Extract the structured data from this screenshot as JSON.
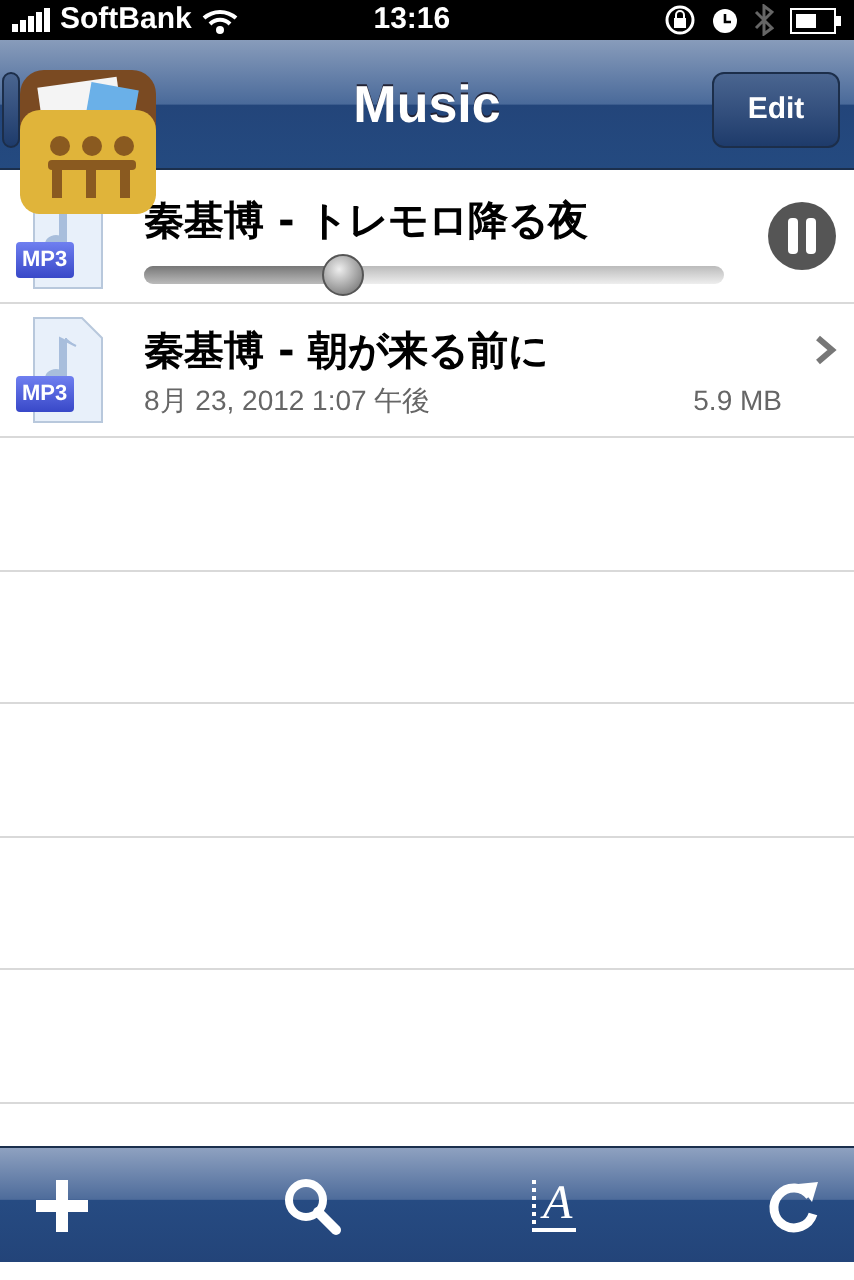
{
  "status_bar": {
    "carrier": "SoftBank",
    "time": "13:16"
  },
  "nav_bar": {
    "title": "Music",
    "edit_button": "Edit"
  },
  "files": [
    {
      "title": "秦基博 - トレモロ降る夜",
      "badge": "MP3",
      "playing": true,
      "level": 0.34
    },
    {
      "title": "秦基博 - 朝が来る前に",
      "badge": "MP3",
      "playing": false,
      "date": "8月 23, 2012 1:07 午後",
      "size": "5.9 MB"
    }
  ],
  "toolbar": {
    "format_glyph": "A"
  }
}
